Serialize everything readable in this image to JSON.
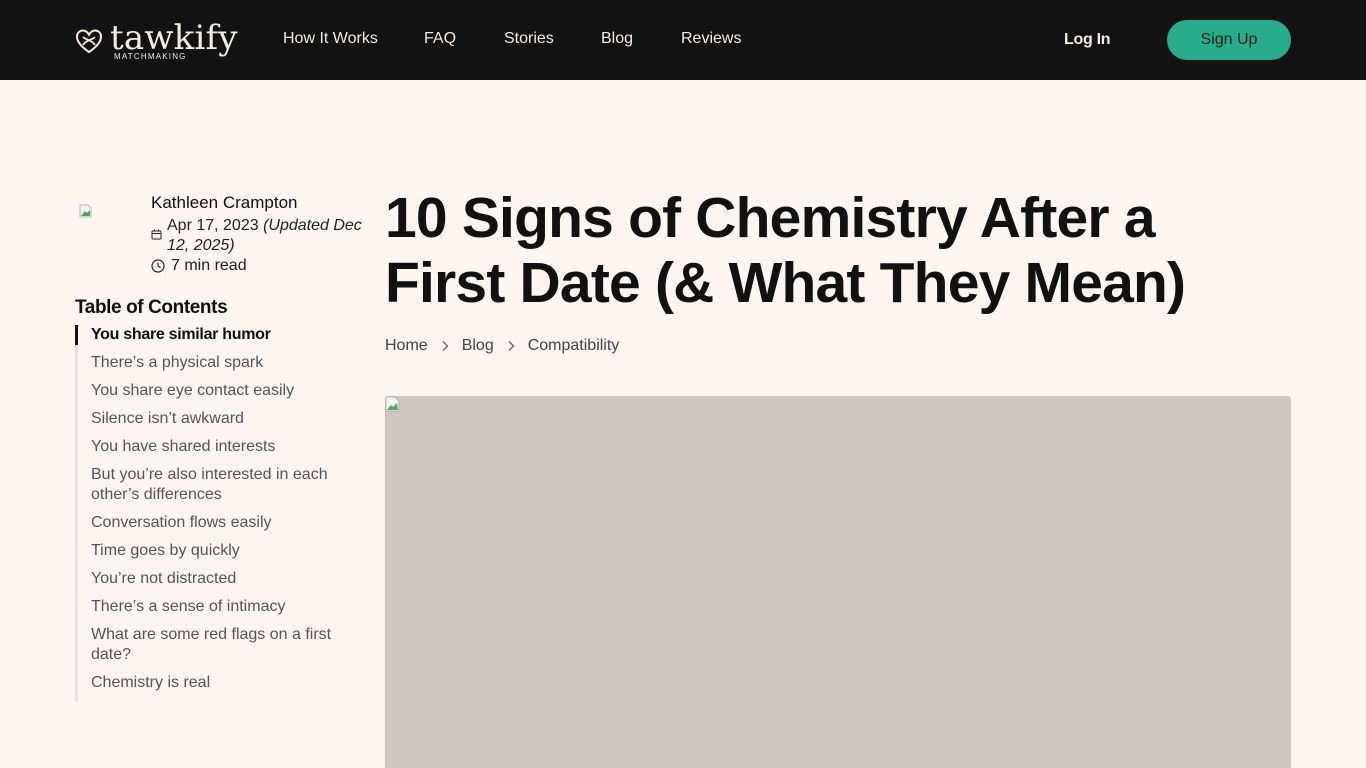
{
  "nav": {
    "brand": "tawkify",
    "brand_sub": "MATCHMAKING",
    "links": [
      "How It Works",
      "FAQ",
      "Stories",
      "Blog",
      "Reviews"
    ],
    "login": "Log In",
    "signup": "Sign Up",
    "accent": "#27ad8b"
  },
  "author": {
    "name": "Kathleen Crampton",
    "date": "Apr 17, 2023",
    "updated": "(Updated Dec 12, 2025)",
    "read_time": "7 min read"
  },
  "toc": {
    "title": "Table of Contents",
    "items": [
      "You share similar humor",
      "There’s a physical spark",
      "You share eye contact easily",
      "Silence isn’t awkward",
      "You have shared interests",
      "But you’re also interested in each other’s differences",
      "Conversation flows easily",
      "Time goes by quickly",
      "You’re not distracted",
      "There’s a sense of intimacy",
      "What are some red flags on a first date?",
      "Chemistry is real"
    ]
  },
  "article": {
    "title": "10 Signs of Chemistry After a First Date (& What They Mean)",
    "breadcrumbs": [
      "Home",
      "Blog",
      "Compatibility"
    ]
  }
}
